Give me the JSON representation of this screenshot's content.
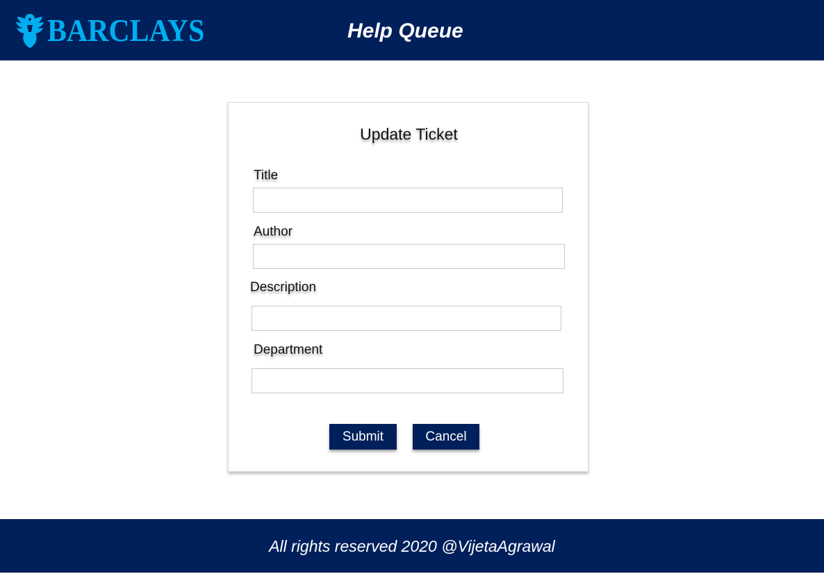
{
  "header": {
    "logo_text": "BARCLAYS",
    "title": "Help Queue",
    "background_color": "#00205b",
    "logo_color": "#00aeef"
  },
  "form": {
    "title": "Update Ticket",
    "fields": [
      {
        "label": "Title",
        "value": "",
        "placeholder": ""
      },
      {
        "label": "Author",
        "value": "",
        "placeholder": ""
      },
      {
        "label": "Description",
        "value": "",
        "placeholder": ""
      },
      {
        "label": "Department",
        "value": "",
        "placeholder": ""
      }
    ],
    "submit_label": "Submit",
    "cancel_label": "Cancel",
    "button_color": "#00205b"
  },
  "footer": {
    "text": "All rights reserved 2020 @VijetaAgrawal"
  }
}
